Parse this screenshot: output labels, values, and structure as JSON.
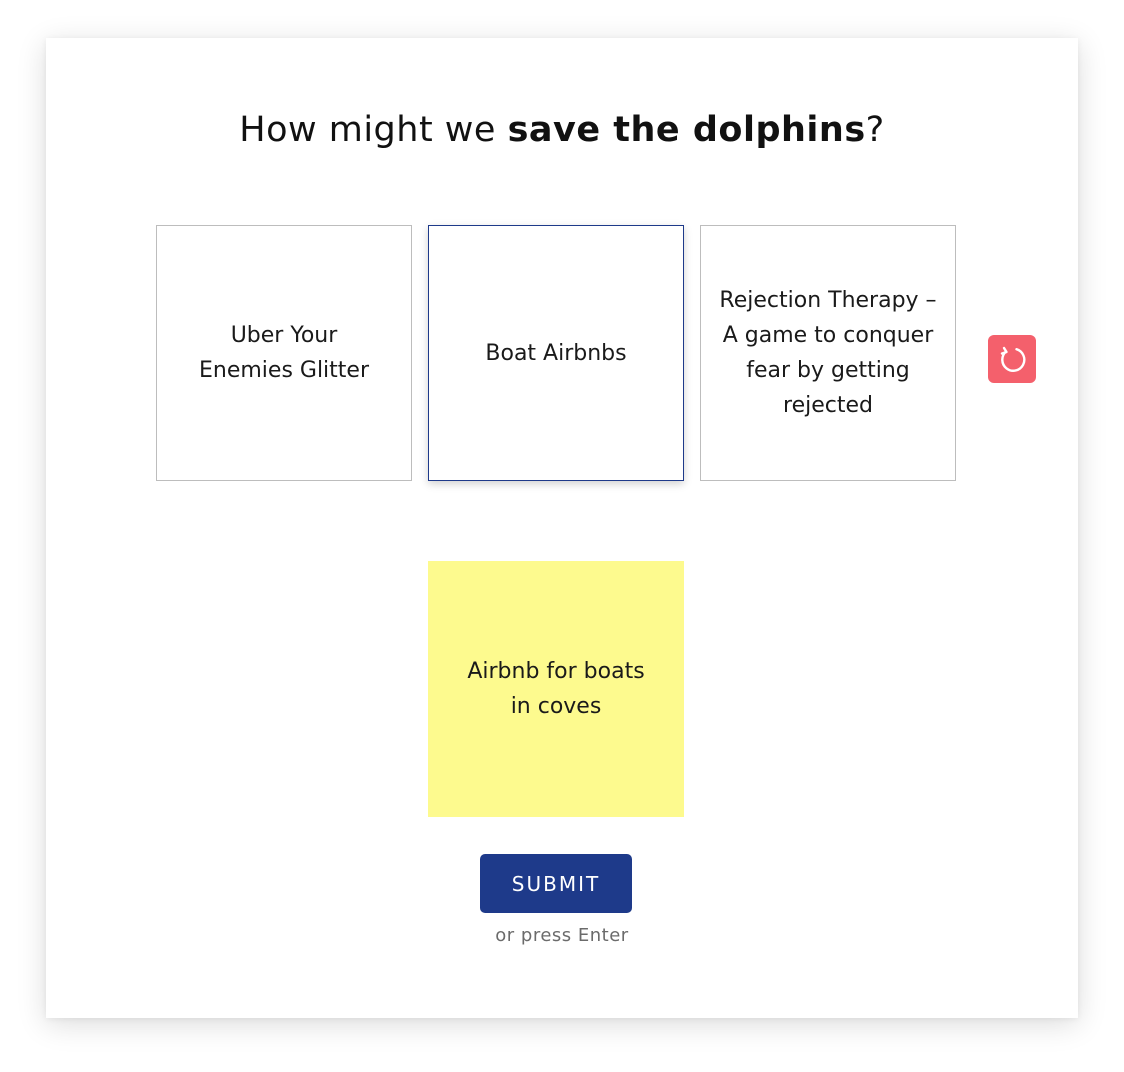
{
  "prompt": {
    "prefix": "How might we ",
    "emphasis": "save the dolphins",
    "suffix": "?"
  },
  "ideas": [
    {
      "text": "Uber Your Enemies Glitter",
      "selected": false
    },
    {
      "text": "Boat Airbnbs",
      "selected": true
    },
    {
      "text": "Rejection Therapy – A game to conquer fear by getting rejected",
      "selected": false
    }
  ],
  "refresh": {
    "icon": "refresh-icon",
    "color": "#f4606c"
  },
  "sticky_note": {
    "text": "Airbnb for boats in coves",
    "color": "#fdfa8e"
  },
  "submit": {
    "label": "SUBMIT",
    "color": "#1e3a8a"
  },
  "hint": "or press Enter"
}
